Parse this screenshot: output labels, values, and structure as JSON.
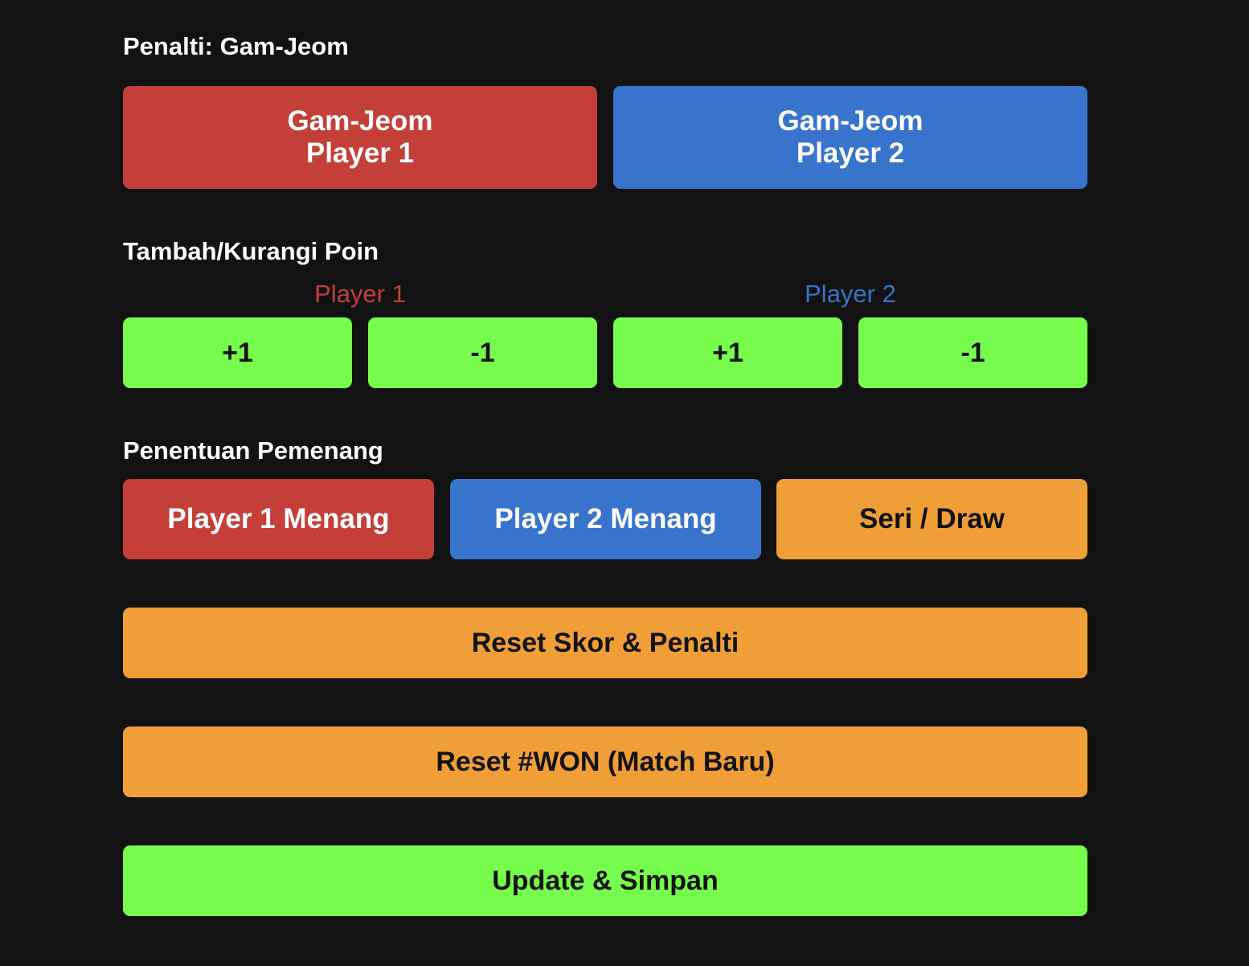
{
  "penalty": {
    "title": "Penalti: Gam-Jeom",
    "player1": {
      "line1": "Gam-Jeom",
      "line2": "Player 1"
    },
    "player2": {
      "line1": "Gam-Jeom",
      "line2": "Player 2"
    }
  },
  "points": {
    "title": "Tambah/Kurangi Poin",
    "player1": {
      "label": "Player 1",
      "plus": "+1",
      "minus": "-1"
    },
    "player2": {
      "label": "Player 2",
      "plus": "+1",
      "minus": "-1"
    }
  },
  "winner": {
    "title": "Penentuan Pemenang",
    "player1_win": "Player 1 Menang",
    "player2_win": "Player 2 Menang",
    "draw": "Seri / Draw"
  },
  "actions": {
    "reset_score": "Reset Skor & Penalti",
    "reset_won": "Reset #WON (Match Baru)",
    "update_save": "Update & Simpan"
  },
  "colors": {
    "background": "#121212",
    "player1": "#c33f38",
    "player2": "#3874cc",
    "positive": "#76fc4c",
    "warning": "#f09e38"
  }
}
